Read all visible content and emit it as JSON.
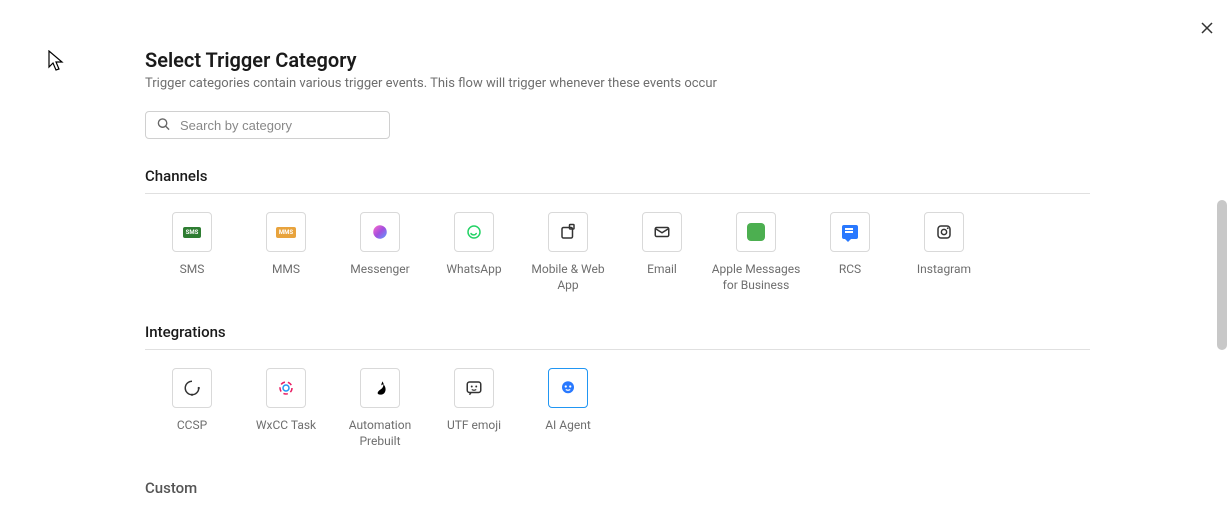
{
  "header": {
    "title": "Select Trigger Category",
    "subtitle": "Trigger categories contain various trigger events. This flow will trigger whenever these events occur"
  },
  "search": {
    "placeholder": "Search by category",
    "value": ""
  },
  "sections": {
    "channels": {
      "title": "Channels",
      "items": [
        {
          "label": "SMS"
        },
        {
          "label": "MMS"
        },
        {
          "label": "Messenger"
        },
        {
          "label": "WhatsApp"
        },
        {
          "label": "Mobile & Web App"
        },
        {
          "label": "Email"
        },
        {
          "label": "Apple Messages for Business"
        },
        {
          "label": "RCS"
        },
        {
          "label": "Instagram"
        }
      ]
    },
    "integrations": {
      "title": "Integrations",
      "items": [
        {
          "label": "CCSP"
        },
        {
          "label": "WxCC Task"
        },
        {
          "label": "Automation Prebuilt"
        },
        {
          "label": "UTF emoji"
        },
        {
          "label": "AI Agent"
        }
      ]
    },
    "custom": {
      "title": "Custom"
    }
  }
}
